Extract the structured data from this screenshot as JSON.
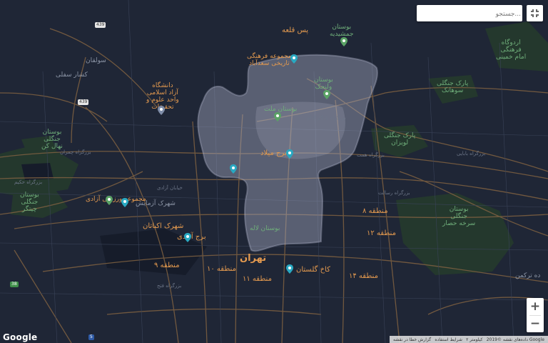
{
  "search": {
    "placeholder": "...جستجو"
  },
  "controls": {
    "zoom_in": "+",
    "zoom_out": "−"
  },
  "branding": {
    "logo": "Google"
  },
  "attribution": {
    "data": "داده‌های نقشه ©2019 Google",
    "scale": "۲ کیلومتر",
    "terms": "شرایط استفاده",
    "report": "گزارش خطا در نقشه"
  },
  "colors": {
    "background": "#1f2636",
    "overlay": "#a9aec5",
    "road": "#8a6a45",
    "park": "#26402f",
    "label": "#e49a4f"
  },
  "labels": {
    "pasqaleh": "پس قلعه",
    "jamshidieh": "بوستان\nجمشیدیه",
    "sadabad": "مجموعه فرهنگی\nتاریخی سعدآباد",
    "velenjak": "بوستان\nولنجک",
    "azad_univ": "دانشگاه\nآزاد اسلامی\nواحد علوم و\nتحقیقات",
    "mellat_park": "بوستان ملت",
    "tehran": "تهران",
    "ekbatan": "شهرک اکباتان",
    "azadi_tower": "برج آزادی",
    "azadi_sports": "مجموعه ورزشی آزادی",
    "golestan": "کاخ گلستان",
    "laleh": "بوستان لاله",
    "milad": "برج میلاد",
    "chitgar": "بوستان\nجنگلی\nچیتگر",
    "lavizan": "پارک جنگلی\nلویزان",
    "sorkhe_hesar": "بوستان\nجنگلی\nسرخه حصار",
    "sohanak": "پارک جنگلی\nسوهانک",
    "artesh": "اردوگاه\nفرهنگی\nامام خمینی",
    "sulqan": "سولقان",
    "keshar": "کشار سفلی",
    "gandhi": "بوستان\nجنگلی\nنهال کن",
    "azar_sahar": "شهرک آزمایش",
    "turki": "ده ترکمن",
    "region_9": "منطقه ۹",
    "region_10": "منطقه ۱۰",
    "region_11": "منطقه ۱۱",
    "region_12": "منطقه ۱۲",
    "region_8": "منطقه ۸",
    "region_14": "منطقه ۱۴",
    "road_chamran": "بزرگراه چمران",
    "road_hemmat": "بزرگراه همت",
    "road_hakim": "بزرگراه حکیم",
    "road_azadi": "خیابان آزادی",
    "road_babayi": "بزرگراه بابایی",
    "road_resalat": "بزرگراه رسالت",
    "road_fath": "بزرگراه فتح",
    "road_yadegar": "بزرگراه یادگار امام"
  },
  "shields": {
    "r439a": "439",
    "r439b": "439",
    "r38": "38",
    "r5": "5"
  }
}
